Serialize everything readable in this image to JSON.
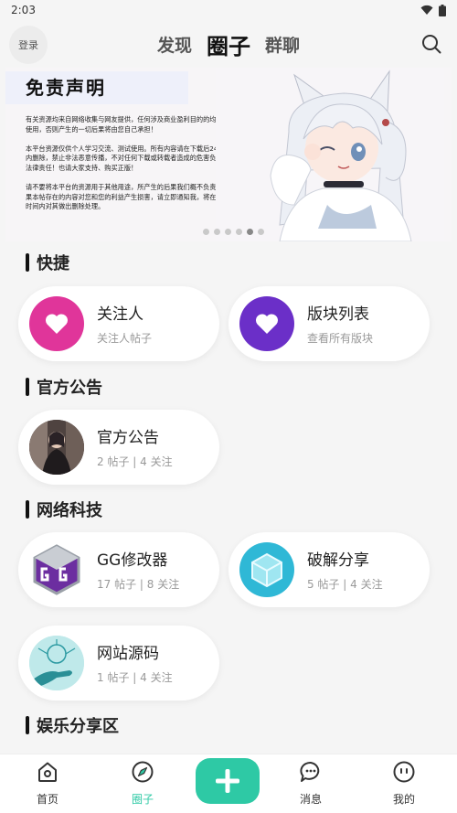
{
  "status_bar": {
    "time": "2:03"
  },
  "header": {
    "login_label": "登录",
    "tabs": [
      {
        "label": "发现"
      },
      {
        "label": "圈子"
      },
      {
        "label": "群聊"
      }
    ],
    "active_tab": "圈子"
  },
  "banner": {
    "title": "免责声明",
    "text": "有关资源均来自网络收集与网友提供，任何涉及商业盈利目的的均不得使用，否则产生的一切后果将由您自己承担！\n\n本平台资源仅供个人学习交流、测试使用。所有内容请在下载后24小时内删除，禁止非法恶意传播，不对任何下载或转载者造成的危害负任何法律责任！也请大家支持、购买正版！\n\n请不要将本平台的资源用于其他用途，所产生的后果我们概不负责！如果本帖存在的内容对您和您的利益产生损害，请立即通知我，将在最短时间内对其做出删除处理。",
    "dot_count": 6,
    "active_dot": 5
  },
  "sections": [
    {
      "title": "快捷",
      "cards": [
        {
          "name": "关注人",
          "sub": "关注人帖子",
          "icon": "heart-icon",
          "color": "#e0359a"
        },
        {
          "name": "版块列表",
          "sub": "查看所有版块",
          "icon": "heart-icon",
          "color": "#6b2fc8"
        }
      ]
    },
    {
      "title": "官方公告",
      "cards": [
        {
          "name": "官方公告",
          "sub": "2 帖子 | 4 关注",
          "icon": "announcement-avatar"
        }
      ]
    },
    {
      "title": "网络科技",
      "cards": [
        {
          "name": "GG修改器",
          "sub": "17 帖子 | 8 关注",
          "icon": "gg-logo-icon"
        },
        {
          "name": "破解分享",
          "sub": "5 帖子 | 4 关注",
          "icon": "box-icon"
        },
        {
          "name": "网站源码",
          "sub": "1 帖子 | 4 关注",
          "icon": "tech-hand-avatar"
        }
      ]
    },
    {
      "title": "娱乐分享区"
    }
  ],
  "bottom_nav": [
    {
      "label": "首页",
      "icon": "home-icon"
    },
    {
      "label": "圈子",
      "icon": "compass-icon"
    },
    {
      "label": "",
      "icon": "plus-icon"
    },
    {
      "label": "消息",
      "icon": "message-icon"
    },
    {
      "label": "我的",
      "icon": "profile-icon"
    }
  ],
  "colors": {
    "accent": "#2ec9a5",
    "pink": "#e0359a",
    "purple": "#6b2fc8"
  }
}
